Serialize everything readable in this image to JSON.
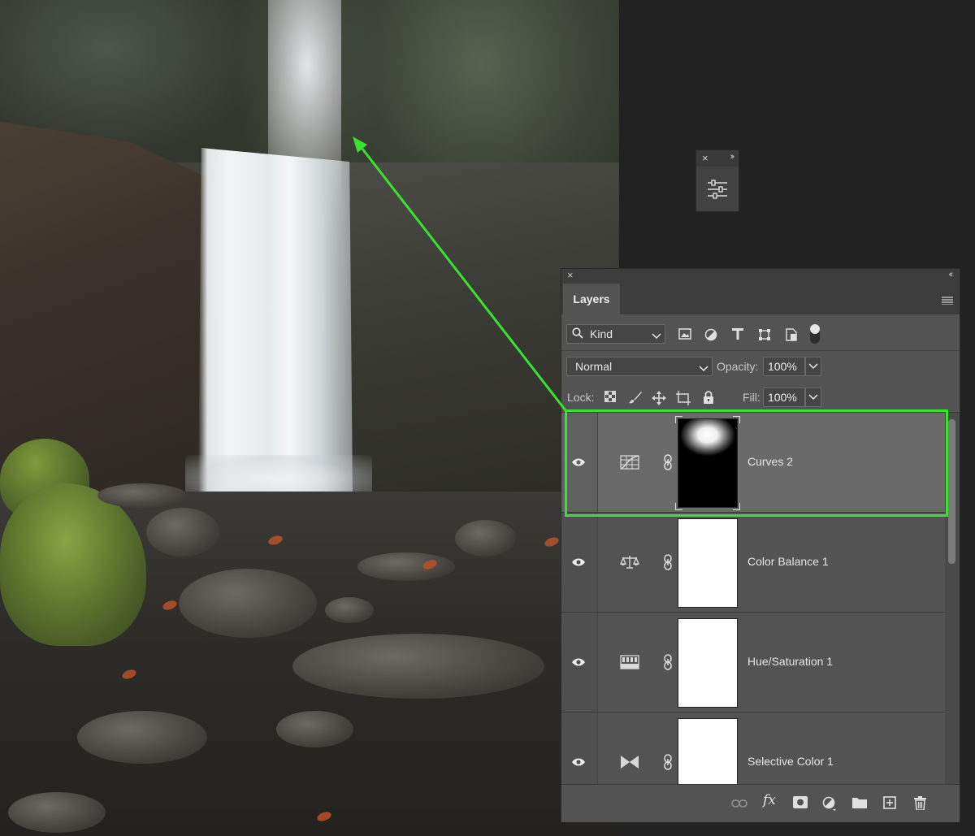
{
  "colors": {
    "highlight": "#39e22f",
    "arrow": "#39e22f",
    "panel_bg": "#535353",
    "selected_row": "#6a6a6a"
  },
  "mini_panel": {
    "close": "×",
    "collapse": "››",
    "icon": "adjustments-sliders-icon"
  },
  "panel": {
    "close": "×",
    "collapse": "‹‹",
    "tab_label": "Layers",
    "filter": {
      "kind_label": "Kind",
      "icons": [
        "image-filter-icon",
        "adjustment-filter-icon",
        "type-filter-icon",
        "shape-filter-icon",
        "smart-object-filter-icon"
      ]
    },
    "blend_mode": "Normal",
    "opacity_label": "Opacity:",
    "opacity_value": "100%",
    "lock_label": "Lock:",
    "lock_icons": [
      "lock-transparent-pixels-icon",
      "lock-image-pixels-icon",
      "lock-position-icon",
      "lock-artboard-icon",
      "lock-all-icon"
    ],
    "fill_label": "Fill:",
    "fill_value": "100%",
    "layers": [
      {
        "name": "Curves 2",
        "icon": "curves-adjustment-icon",
        "selected": true
      },
      {
        "name": "Color Balance 1",
        "icon": "color-balance-icon",
        "selected": false
      },
      {
        "name": "Hue/Saturation 1",
        "icon": "hue-saturation-icon",
        "selected": false
      },
      {
        "name": "Selective Color 1",
        "icon": "selective-color-icon",
        "selected": false
      }
    ],
    "bottom_icons": [
      "link-layers-icon",
      "fx-icon",
      "add-mask-icon",
      "new-adjustment-icon",
      "new-group-icon",
      "new-layer-icon",
      "delete-layer-icon"
    ],
    "fx_label": "fx"
  }
}
